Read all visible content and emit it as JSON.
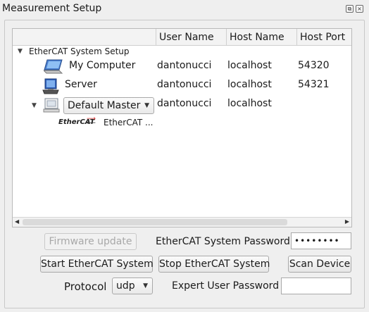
{
  "window": {
    "title": "Measurement Setup"
  },
  "tree": {
    "columns": [
      "",
      "User Name",
      "Host Name",
      "Host Port"
    ],
    "group_label": "EtherCAT System Setup",
    "rows": [
      {
        "name": "My Computer",
        "icon": "laptop-icon",
        "user": "dantonucci",
        "host": "localhost",
        "port": "54320"
      },
      {
        "name": "Server",
        "icon": "server-icon",
        "user": "dantonucci",
        "host": "localhost",
        "port": "54321"
      },
      {
        "name": "Default Master",
        "icon": "master-icon",
        "user": "dantonucci",
        "host": "localhost",
        "port": ""
      }
    ],
    "child": {
      "logo_text": "EtherCAT",
      "label": "EtherCAT ..."
    }
  },
  "buttons": {
    "firmware_update": "Firmware update",
    "start": "Start EtherCAT System",
    "stop": "Stop EtherCAT System",
    "scan": "Scan Device"
  },
  "form": {
    "system_password_label": "EtherCAT System Password",
    "system_password_value": "••••••••",
    "protocol_label": "Protocol",
    "protocol_value": "udp",
    "expert_password_label": "Expert User Password",
    "expert_password_value": ""
  }
}
